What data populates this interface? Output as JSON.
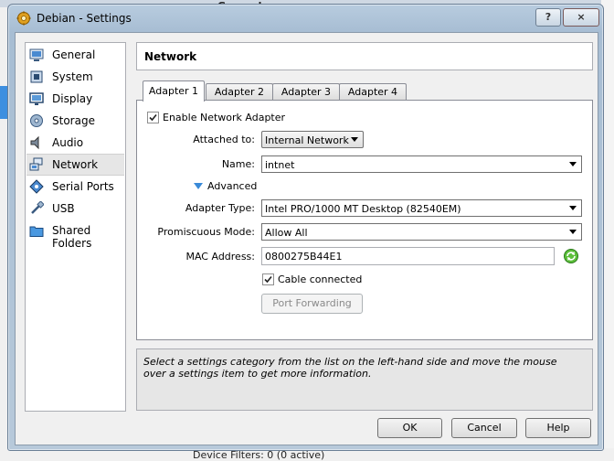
{
  "background": {
    "top_label": "General",
    "bottom_label": "Device Filters:   0 (0 active)"
  },
  "window": {
    "title": "Debian - Settings",
    "help_glyph": "?",
    "close_glyph": "×"
  },
  "categories": [
    {
      "label": "General",
      "icon": "general-icon"
    },
    {
      "label": "System",
      "icon": "system-icon"
    },
    {
      "label": "Display",
      "icon": "display-icon"
    },
    {
      "label": "Storage",
      "icon": "storage-icon"
    },
    {
      "label": "Audio",
      "icon": "audio-icon"
    },
    {
      "label": "Network",
      "icon": "network-icon",
      "selected": true
    },
    {
      "label": "Serial Ports",
      "icon": "serial-ports-icon"
    },
    {
      "label": "USB",
      "icon": "usb-icon"
    },
    {
      "label": "Shared Folders",
      "icon": "shared-folders-icon"
    }
  ],
  "page_title": "Network",
  "tabs": [
    "Adapter 1",
    "Adapter 2",
    "Adapter 3",
    "Adapter 4"
  ],
  "active_tab": "Adapter 1",
  "form": {
    "enable_label": "Enable Network Adapter",
    "enable_checked": true,
    "attached_label": "Attached to:",
    "attached_value": "Internal Network",
    "name_label": "Name:",
    "name_value": "intnet",
    "advanced_label": "Advanced",
    "adapter_type_label": "Adapter Type:",
    "adapter_type_value": "Intel PRO/1000 MT Desktop (82540EM)",
    "promiscuous_label": "Promiscuous Mode:",
    "promiscuous_value": "Allow All",
    "mac_label": "MAC Address:",
    "mac_value": "0800275B44E1",
    "cable_label": "Cable connected",
    "cable_checked": true,
    "port_forwarding_label": "Port Forwarding"
  },
  "info_text": "Select a settings category from the list on the left-hand side and move the mouse over a settings item to get more information.",
  "buttons": {
    "ok": "OK",
    "cancel": "Cancel",
    "help": "Help"
  }
}
